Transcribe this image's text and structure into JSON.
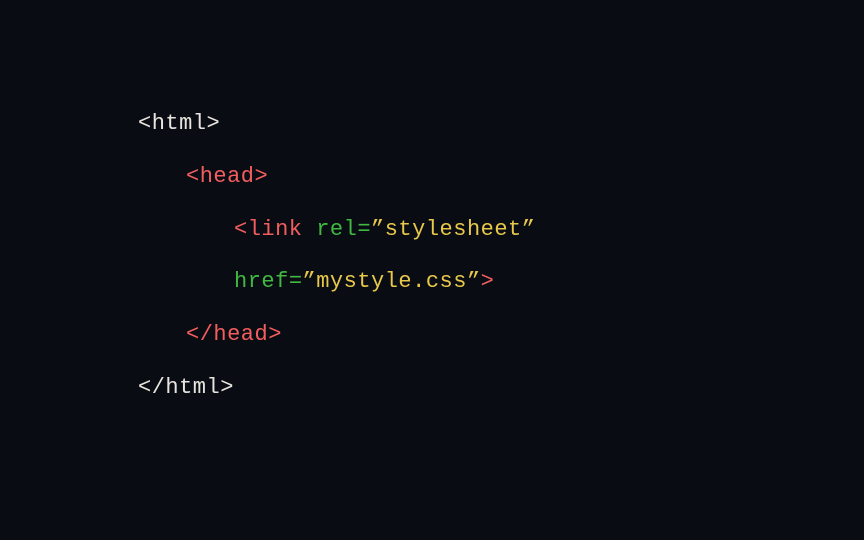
{
  "code": {
    "line1": {
      "open": "<",
      "tag": "html",
      "close": ">"
    },
    "line2": {
      "open": "<",
      "tag": "head",
      "close": ">"
    },
    "line3": {
      "open": "<",
      "tag": "link",
      "sp1": " ",
      "attr1": "rel",
      "eq1": "=",
      "val1": "”stylesheet”"
    },
    "line4": {
      "attr2": "href",
      "eq2": "=",
      "val2": "”mystyle.css”",
      "close": ">"
    },
    "line5": {
      "open": "</",
      "tag": "head",
      "close": ">"
    },
    "line6": {
      "open": "</",
      "tag": "html",
      "close": ">"
    }
  }
}
